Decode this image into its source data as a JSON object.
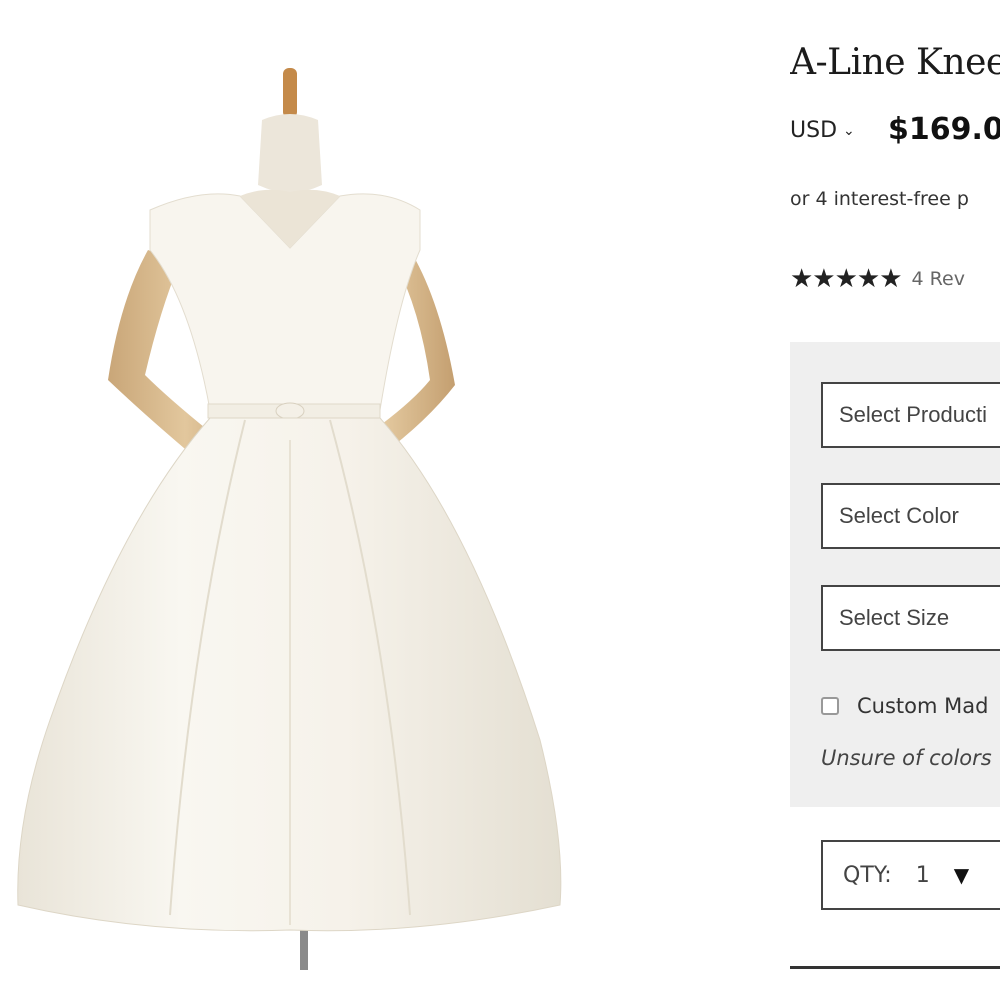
{
  "product": {
    "title": "A-Line Knee",
    "currency": "USD",
    "currency_chevron": "chevron-down-icon",
    "price": "$169.0",
    "installment_text": "or 4 interest-free p",
    "stars": "★★★★★",
    "reviews_text": "4 Rev"
  },
  "options": {
    "production_placeholder": "Select Producti",
    "color_placeholder": "Select Color",
    "size_placeholder": "Select Size",
    "custom_made_label": "Custom Mad",
    "unsure_text": "Unsure of colors"
  },
  "quantity": {
    "label": "QTY:",
    "value": "1",
    "arrow": "▼"
  },
  "colors": {
    "panel_bg": "#efefef",
    "text": "#222222",
    "border": "#444444",
    "mannequin_wood": "#d9b98a",
    "dress": "#f8f5ee"
  }
}
